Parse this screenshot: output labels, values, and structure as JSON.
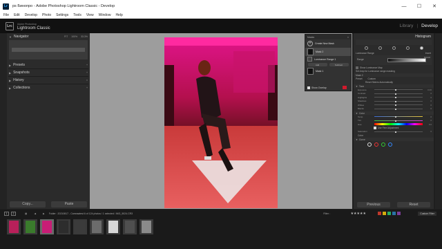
{
  "window": {
    "title": "ps Бинопро - Adobe Photoshop Lightroom Classic - Develop",
    "minimize": "—",
    "maximize": "☐",
    "close": "✕"
  },
  "menu": [
    "File",
    "Edit",
    "Develop",
    "Photo",
    "Settings",
    "Tools",
    "View",
    "Window",
    "Help"
  ],
  "app": {
    "logo": "Lrc",
    "brand_top": "Adobe Photoshop",
    "brand_name": "Lightroom Classic",
    "modules": [
      "Library",
      "Develop"
    ],
    "module_sep": "|",
    "active_module": "Develop"
  },
  "left_panel": {
    "navigator": {
      "title": "Navigator",
      "zoom_options": [
        "FIT",
        "100%",
        "33.3%"
      ]
    },
    "sections": [
      "Presets",
      "Snapshots",
      "History",
      "Collections"
    ],
    "copy_label": "Copy...",
    "paste_label": "Paste"
  },
  "masks": {
    "title": "Masks",
    "create_label": "Create New Mask",
    "items": [
      {
        "label": "Mask 2",
        "selected": true
      },
      {
        "label": "Luminance Range 1",
        "selected": false
      },
      {
        "label": "Mask 1",
        "selected": false
      }
    ],
    "add_label": "Add",
    "subtract_label": "Subtract",
    "show_overlay_label": "Show Overlay",
    "overlay_color": "#d21a2c"
  },
  "right_panel": {
    "histogram_label": "Histogram",
    "luminance_range_label": "Luminance Range",
    "invert_label": "Invert",
    "range_label": "Range",
    "range_value": "81/100",
    "show_luminance_map": "Show Luminance Map",
    "refine_label": "Set Amp for Luminance range masking",
    "mask2_label": "Mask 2",
    "preset_label": "Preset",
    "preset_value": "Custom",
    "auto_label": "Reset Sliders Automatically",
    "tone_label": "Tone",
    "tone_sliders": [
      {
        "label": "Exposure",
        "value": "0.00"
      },
      {
        "label": "Contrast",
        "value": "0"
      },
      {
        "label": "Highlights",
        "value": "0"
      },
      {
        "label": "Shadows",
        "value": "0"
      },
      {
        "label": "Whites",
        "value": "0"
      },
      {
        "label": "Blacks",
        "value": "0"
      }
    ],
    "color_label": "Color",
    "color_sliders": [
      {
        "label": "Temp",
        "value": "0"
      },
      {
        "label": "Tint",
        "value": "0"
      },
      {
        "label": "Hue",
        "value": "0.0"
      }
    ],
    "fine_adjust_label": "Use Fine Adjustment",
    "saturation_label": "Saturation",
    "saturation_value": "0",
    "color_sub_label": "Color",
    "curve_label": "Curve",
    "previous_label": "Previous",
    "reset_label": "Reset"
  },
  "filmstrip": {
    "page_numbers": [
      "1",
      "2"
    ],
    "info": "Folder : 20210817 - Camrawtest   6 of 124 photos / 1 selected / IMG_5024.CR3",
    "filter_label": "Filter :",
    "stars": "★★★★★",
    "custom_filter": "Custom Filter",
    "swatch_colors": [
      "#c0392b",
      "#d4ac0d",
      "#27ae60",
      "#2874a6",
      "#7d3c98"
    ],
    "thumb_colors": [
      "#b8205a",
      "#3a7b2c",
      "#c81d76",
      "#2d2d2d",
      "#3b3b3b",
      "#6c6c6c",
      "#d7d7d7",
      "#4f4f4f",
      "#8a8a8a"
    ]
  }
}
